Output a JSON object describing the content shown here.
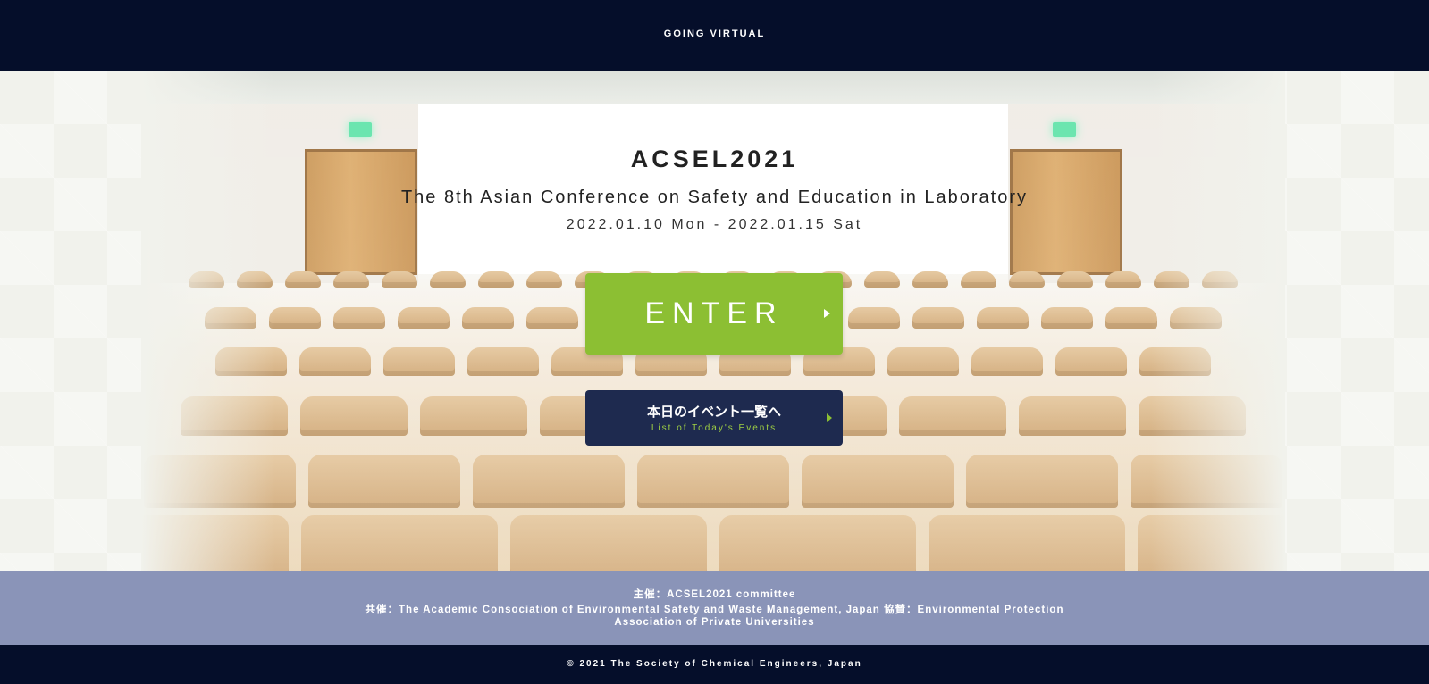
{
  "header": {
    "title": "GOING VIRTUAL"
  },
  "hero": {
    "title": "ACSEL2021",
    "subtitle": "The 8th Asian Conference on Safety and Education in Laboratory",
    "dates": "2022.01.10 Mon - 2022.01.15 Sat"
  },
  "enter_button": {
    "label": "ENTER"
  },
  "events_button": {
    "label_jp": "本日のイベント一覧へ",
    "label_en": "List of Today's Events"
  },
  "sponsors": {
    "line1": "主催：ACSEL2021 committee",
    "line2": "共催：The Academic Consociation of Environmental Safety and Waste Management, Japan 協賛：Environmental Protection",
    "line3": "Association of Private Universities"
  },
  "footer": {
    "copyright": "© 2021 The Society of Chemical Engineers, Japan"
  },
  "colors": {
    "navy": "#050e2a",
    "green": "#8cbf33",
    "button_navy": "#1e2a4f",
    "sponsor_band": "#8a94b8"
  }
}
